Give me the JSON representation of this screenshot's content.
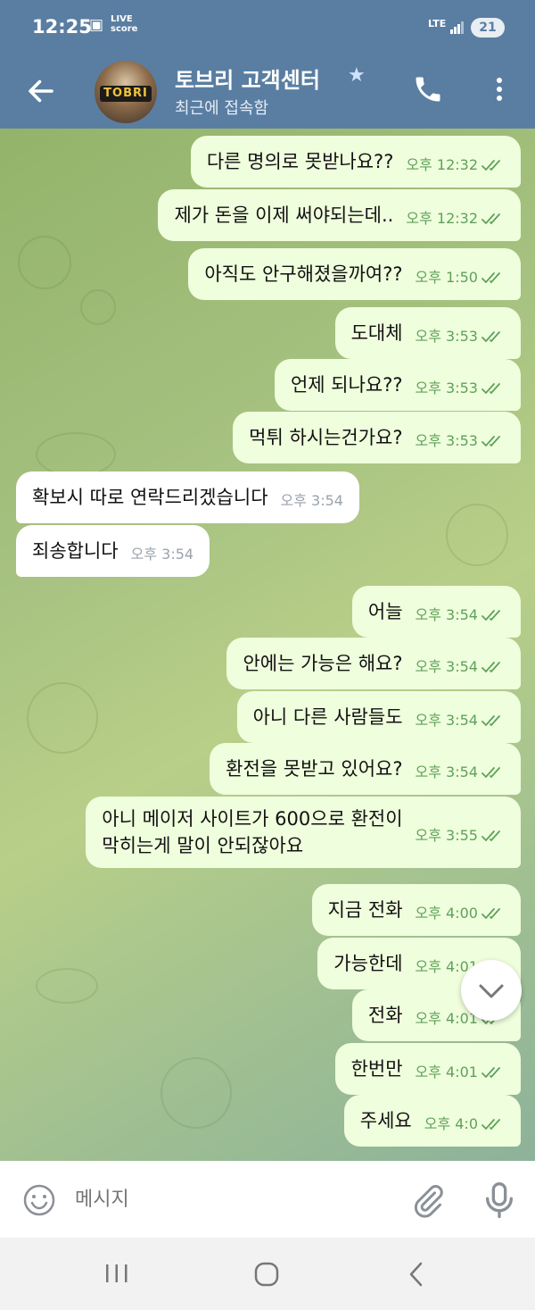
{
  "status_bar": {
    "time": "12:25",
    "live_line1": "LIVE",
    "live_line2": "score",
    "network": "LTE",
    "battery": "21"
  },
  "header": {
    "contact_name": "토브리 고객센터",
    "contact_status": "최근에 접속함",
    "avatar_logo": "TOBRI",
    "icons": [
      "back-arrow-icon",
      "star-icon",
      "phone-icon",
      "more-vert-icon"
    ],
    "accent_color": "#5a7ea2"
  },
  "messages": [
    {
      "dir": "out",
      "text": "다른 명의로 못받나요??",
      "time": "오후 12:32"
    },
    {
      "dir": "out",
      "text": "제가 돈을 이제 써야되는데..",
      "time": "오후 12:32"
    },
    {
      "dir": "out",
      "text": "아직도 안구해졌을까여??",
      "time": "오후 1:50"
    },
    {
      "dir": "out",
      "text": "도대체",
      "time": "오후 3:53"
    },
    {
      "dir": "out",
      "text": "언제 되나요??",
      "time": "오후 3:53"
    },
    {
      "dir": "out",
      "text": "먹튀 하시는건가요?",
      "time": "오후 3:53"
    },
    {
      "dir": "in",
      "text": "확보시 따로 연락드리겠습니다",
      "time": "오후 3:54"
    },
    {
      "dir": "in",
      "text": "죄송합니다",
      "time": "오후 3:54"
    },
    {
      "dir": "out",
      "text": "어늘",
      "time": "오후 3:54"
    },
    {
      "dir": "out",
      "text": "안에는 가능은 해요?",
      "time": "오후 3:54"
    },
    {
      "dir": "out",
      "text": "아니 다른 사람들도",
      "time": "오후 3:54"
    },
    {
      "dir": "out",
      "text": "환전을 못받고 있어요?",
      "time": "오후 3:54"
    },
    {
      "dir": "out",
      "text": "아니 메이저 사이트가 600으로 환전이\n막히는게 말이 안되잖아요",
      "time": "오후 3:55"
    },
    {
      "dir": "out",
      "text": "지금 전화",
      "time": "오후 4:00"
    },
    {
      "dir": "out",
      "text": "가능한데",
      "time": "오후 4:01"
    },
    {
      "dir": "out",
      "text": "전화",
      "time": "오후 4:01"
    },
    {
      "dir": "out",
      "text": "한번만",
      "time": "오후 4:01"
    },
    {
      "dir": "out",
      "text": "주세요",
      "time": "오후 4:0"
    }
  ],
  "colors": {
    "outgoing_bubble": "#effedd",
    "incoming_bubble": "#ffffff",
    "read_tick": "#5fa15a"
  },
  "input": {
    "placeholder": "메시지",
    "icons": [
      "emoji-icon",
      "attach-icon",
      "mic-icon"
    ]
  },
  "scroll_button_icon": "chevron-down-icon",
  "nav_icons": [
    "recent-apps-icon",
    "home-icon",
    "back-icon"
  ]
}
